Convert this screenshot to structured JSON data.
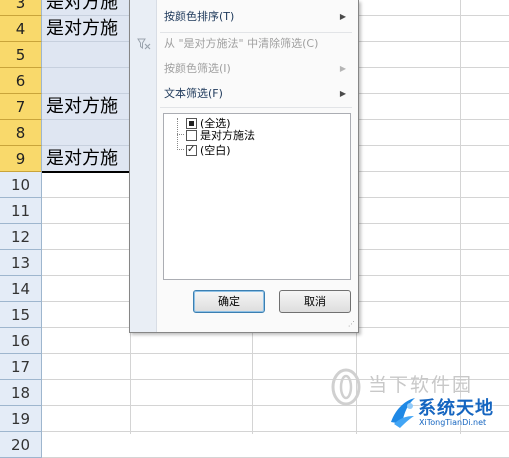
{
  "spreadsheet": {
    "rows": [
      {
        "num": "3",
        "cell": "是对方施",
        "selected": true
      },
      {
        "num": "4",
        "cell": "是对方施",
        "selected": true
      },
      {
        "num": "5",
        "cell": "",
        "selected": true
      },
      {
        "num": "6",
        "cell": "",
        "selected": true
      },
      {
        "num": "7",
        "cell": "是对方施",
        "selected": true
      },
      {
        "num": "8",
        "cell": "",
        "selected": true
      },
      {
        "num": "9",
        "cell": "是对方施",
        "selected": true
      },
      {
        "num": "10",
        "cell": "",
        "selected": false
      },
      {
        "num": "11",
        "cell": "",
        "selected": false
      },
      {
        "num": "12",
        "cell": "",
        "selected": false
      },
      {
        "num": "13",
        "cell": "",
        "selected": false
      },
      {
        "num": "14",
        "cell": "",
        "selected": false
      },
      {
        "num": "15",
        "cell": "",
        "selected": false
      },
      {
        "num": "16",
        "cell": "",
        "selected": false
      },
      {
        "num": "17",
        "cell": "",
        "selected": false
      },
      {
        "num": "18",
        "cell": "",
        "selected": false
      },
      {
        "num": "19",
        "cell": "",
        "selected": false
      },
      {
        "num": "20",
        "cell": "",
        "selected": false
      }
    ]
  },
  "filter_menu": {
    "sort_by_color": "按颜色排序(T)",
    "clear_filter": "从 \"是对方施法\" 中清除筛选(C)",
    "filter_by_color": "按颜色筛选(I)",
    "text_filters": "文本筛选(F)",
    "list": {
      "select_all": "(全选)",
      "item_1": "是对方施法",
      "item_blank": "(空白)"
    },
    "ok_label": "确定",
    "cancel_label": "取消"
  },
  "watermarks": {
    "top_text": "当下软件园",
    "bottom_title": "系统天地",
    "bottom_sub": "XiTongTianDi.net"
  },
  "colors": {
    "selected_row_header": "#f9d96b",
    "selected_cell": "#dfe6f2",
    "menu_text": "#1e395b",
    "disabled_text": "#a0a0a0",
    "brand_blue": "#1565c0"
  }
}
